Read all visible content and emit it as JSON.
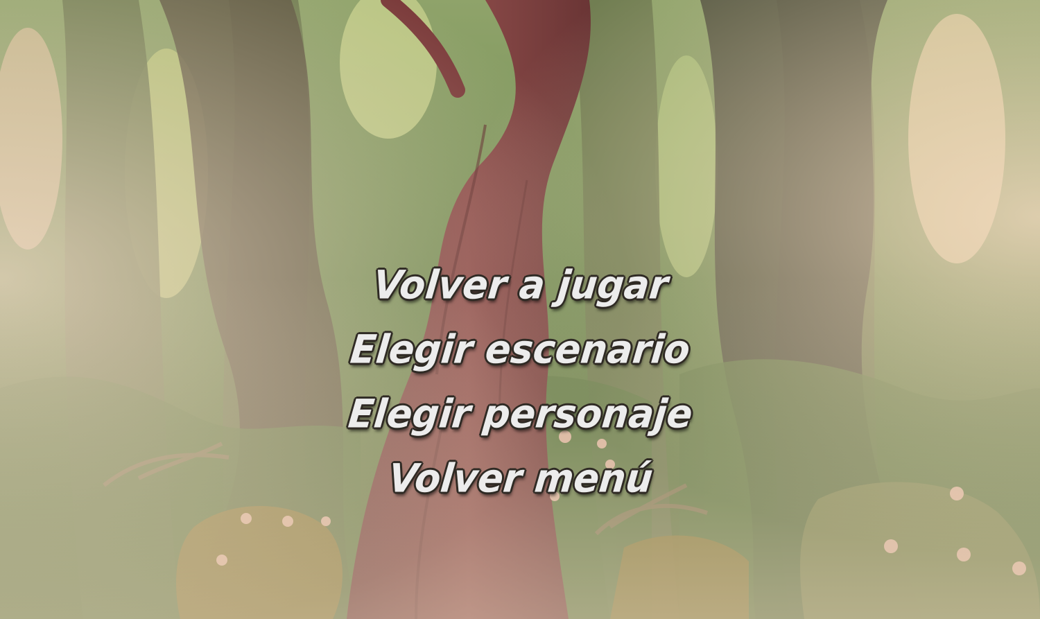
{
  "game": {
    "screen": "game-over-menu",
    "background": "forest"
  },
  "menu": {
    "items": [
      {
        "label": "Volver a jugar"
      },
      {
        "label": "Elegir escenario"
      },
      {
        "label": "Elegir personaje"
      },
      {
        "label": "Volver menú"
      }
    ]
  },
  "colors": {
    "menu_text": "#ececec",
    "menu_outline": "#2f2a24",
    "tree_trunk": "#7a4040",
    "foliage": "#5f7a45",
    "fog": "#e8d8c4"
  }
}
